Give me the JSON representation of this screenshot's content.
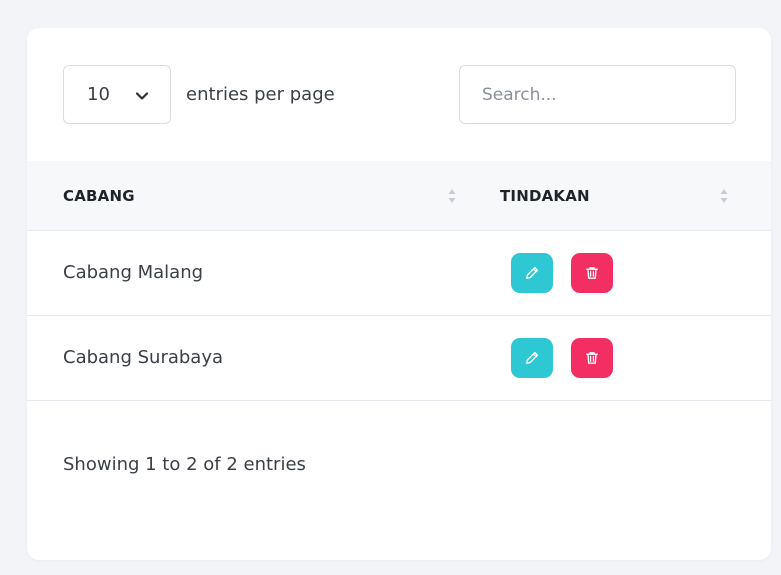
{
  "length_select": {
    "value": "10",
    "icon": "chevron-down-icon"
  },
  "per_page_label": "entries per page",
  "search": {
    "placeholder": "Search...",
    "value": ""
  },
  "table": {
    "columns": [
      {
        "label": "CABANG",
        "sort_icon": "sort-icon"
      },
      {
        "label": "TINDAKAN",
        "sort_icon": "sort-icon"
      }
    ],
    "rows": [
      {
        "cabang": "Cabang Malang",
        "actions": [
          "pencil-icon",
          "trash-icon"
        ]
      },
      {
        "cabang": "Cabang Surabaya",
        "actions": [
          "pencil-icon",
          "trash-icon"
        ]
      }
    ]
  },
  "info": "Showing 1 to 2 of 2 entries",
  "colors": {
    "edit": "#2ec7d4",
    "delete": "#f22e63",
    "header_bg": "#f6f8fa",
    "page_bg": "#f2f4f7"
  }
}
